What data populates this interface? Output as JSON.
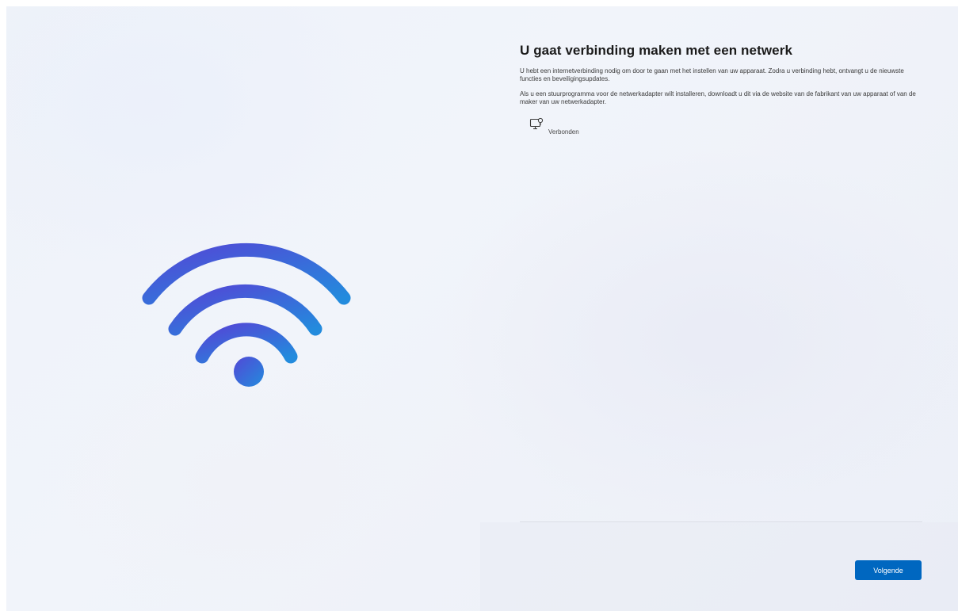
{
  "page": {
    "title": "U gaat verbinding maken met een netwerk",
    "paragraph_1": "U hebt een internetverbinding nodig om door te gaan met het instellen van uw apparaat. Zodra u verbinding hebt, ontvangt u de nieuwste functies en beveiligingsupdates.",
    "paragraph_2": "Als u een stuurprogramma voor de netwerkadapter wilt installeren, downloadt u dit via de website van de fabrikant van uw apparaat of van de maker van uw netwerkadapter."
  },
  "network": {
    "icon": "wired-network-icon",
    "status": "Verbonden"
  },
  "illustration": {
    "icon": "wifi-icon",
    "colors": {
      "start": "#4a4fd8",
      "end": "#2a86e0"
    }
  },
  "footer": {
    "next_label": "Volgende"
  },
  "colors": {
    "accent": "#0067c0",
    "background": "#eef2f9"
  }
}
